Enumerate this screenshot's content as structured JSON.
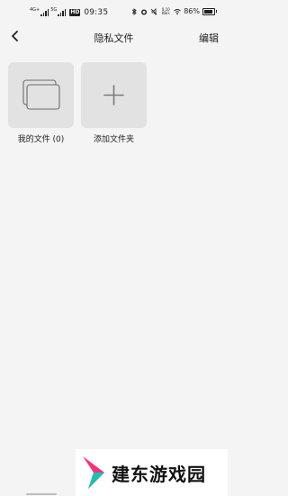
{
  "status_bar": {
    "network_left": "4G+",
    "network_right": "5G",
    "hd_badge": "HD",
    "time": "09:35",
    "speed": "0.10 KB/s",
    "battery_percent": "86%",
    "battery_level": 0.86
  },
  "nav": {
    "title": "隐私文件",
    "edit_label": "编辑"
  },
  "folders": [
    {
      "label": "我的文件 (0)",
      "icon": "folder-stack-icon"
    },
    {
      "label": "添加文件夹",
      "icon": "plus-icon"
    }
  ],
  "watermark": {
    "text": "建东游戏园",
    "colors": {
      "pink": "#ff2f7a",
      "teal": "#16c2b0"
    }
  }
}
